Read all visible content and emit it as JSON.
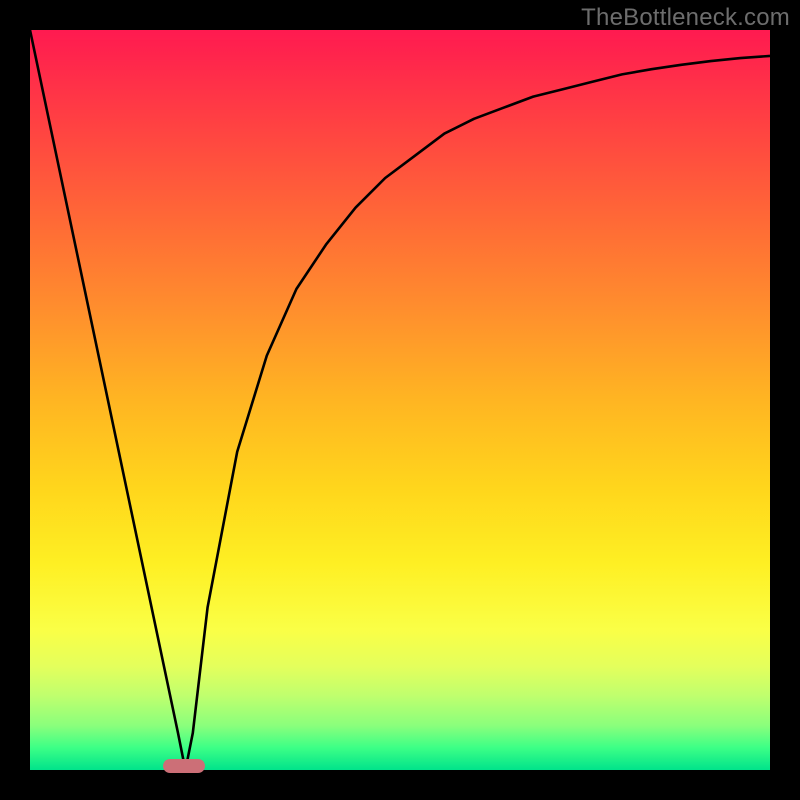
{
  "watermark": "TheBottleneck.com",
  "colors": {
    "frame_bg": "#000000",
    "gradient_top": "#ff1a50",
    "gradient_bottom": "#00e38b",
    "curve_stroke": "#000000",
    "marker_fill": "#cc6f77",
    "watermark_text": "#6d6d6d"
  },
  "chart_data": {
    "type": "line",
    "title": "",
    "xlabel": "",
    "ylabel": "",
    "xlim": [
      0,
      100
    ],
    "ylim": [
      0,
      100
    ],
    "grid": false,
    "legend": false,
    "note": "Axis unlabeled in source image; values are normalized 0–100 estimates read from pixel positions.",
    "series": [
      {
        "name": "curve",
        "x": [
          0,
          4,
          8,
          12,
          16,
          20,
          21,
          22,
          24,
          28,
          32,
          36,
          40,
          44,
          48,
          52,
          56,
          60,
          64,
          68,
          72,
          76,
          80,
          84,
          88,
          92,
          96,
          100
        ],
        "y": [
          100,
          81,
          62,
          43,
          24,
          5,
          0,
          5,
          22,
          43,
          56,
          65,
          71,
          76,
          80,
          83,
          86,
          88,
          89.5,
          91,
          92,
          93,
          94,
          94.7,
          95.3,
          95.8,
          96.2,
          96.5
        ]
      }
    ],
    "marker": {
      "shape": "rounded-rect",
      "x_center": 20.8,
      "y": 0,
      "width_pct": 5.7,
      "fill": "#cc6f77"
    },
    "background": {
      "type": "vertical-gradient",
      "stops": [
        {
          "pos": 0.0,
          "color": "#ff1a50"
        },
        {
          "pos": 0.5,
          "color": "#ffb522"
        },
        {
          "pos": 0.81,
          "color": "#faff46"
        },
        {
          "pos": 1.0,
          "color": "#00e38b"
        }
      ]
    }
  }
}
